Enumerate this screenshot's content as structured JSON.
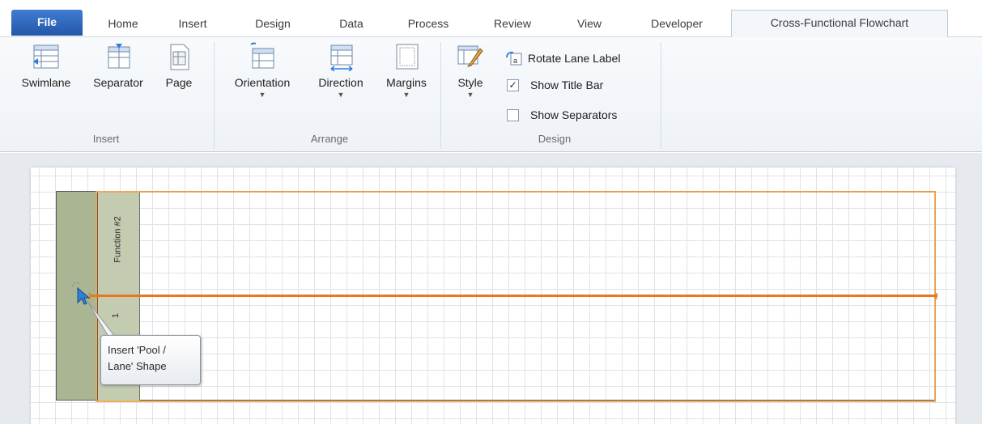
{
  "tabs": [
    "File",
    "Home",
    "Insert",
    "Design",
    "Data",
    "Process",
    "Review",
    "View",
    "Developer",
    "Cross-Functional Flowchart"
  ],
  "active_tab": "Cross-Functional Flowchart",
  "ribbon": {
    "insert": {
      "swimlane": "Swimlane",
      "separator": "Separator",
      "page": "Page",
      "label": "Insert"
    },
    "arrange": {
      "orientation": "Orientation",
      "direction": "Direction",
      "margins": "Margins",
      "label": "Arrange"
    },
    "design": {
      "style": "Style",
      "rotate_lane_label": "Rotate Lane Label",
      "show_title_bar": "Show Title Bar",
      "show_title_bar_checked": true,
      "show_separators": "Show Separators",
      "show_separators_checked": false,
      "label": "Design"
    }
  },
  "canvas": {
    "lane_label_top": "Function #2",
    "lane_label_bottom": "1",
    "tooltip_line1": "Insert 'Pool /",
    "tooltip_line2": "Lane' Shape"
  },
  "colors": {
    "file_tab": "#2f6bc4",
    "pool_header": "#a9b593",
    "lane_header": "#c3cbb0",
    "insert_line": "#e87722"
  }
}
